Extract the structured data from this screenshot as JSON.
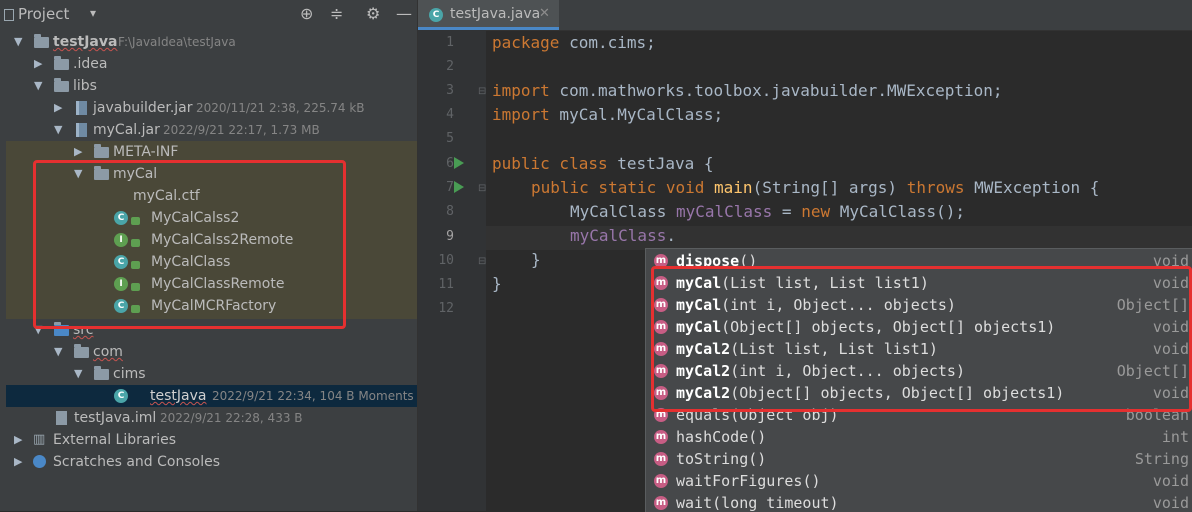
{
  "project": {
    "title": "Project",
    "tree": [
      {
        "label": "testJava",
        "meta": "F:\\JavaIdea\\testJava"
      },
      {
        "label": ".idea"
      },
      {
        "label": "libs"
      },
      {
        "label": "javabuilder.jar",
        "meta": "2020/11/21 2:38, 225.74 kB"
      },
      {
        "label": "myCal.jar",
        "meta": "2022/9/21 22:17, 1.73 MB"
      },
      {
        "label": "META-INF"
      },
      {
        "label": "myCal"
      },
      {
        "label": "myCal.ctf"
      },
      {
        "label": "MyCalCalss2"
      },
      {
        "label": "MyCalCalss2Remote"
      },
      {
        "label": "MyCalClass"
      },
      {
        "label": "MyCalClassRemote"
      },
      {
        "label": "MyCalMCRFactory"
      },
      {
        "label": "src"
      },
      {
        "label": "com"
      },
      {
        "label": "cims"
      },
      {
        "label": "testJava",
        "meta": "2022/9/21 22:34, 104 B Moments ago"
      },
      {
        "label": "testJava.iml",
        "meta": "2022/9/21 22:28, 433 B"
      },
      {
        "label": "External Libraries"
      },
      {
        "label": "Scratches and Consoles"
      }
    ]
  },
  "editor": {
    "tab": "testJava.java",
    "line_numbers": [
      "1",
      "2",
      "3",
      "4",
      "5",
      "6",
      "7",
      "8",
      "9",
      "10",
      "11",
      "12"
    ],
    "code": {
      "l1_kw": "package",
      "l1_rest": " com.cims;",
      "l3_kw": "import",
      "l3_rest": " com.mathworks.toolbox.javabuilder.MWException;",
      "l4_kw": "import",
      "l4_rest": " myCal.MyCalClass;",
      "l6_kw": "public class",
      "l6_rest": " testJava {",
      "l7_kw1": "public static void",
      "l7_fn": " main",
      "l7_mid": "(String[] args) ",
      "l7_kw2": "throws",
      "l7_end": " MWException {",
      "l8_type": "MyCalClass ",
      "l8_var": "myCalClass",
      "l8_eq": " = ",
      "l8_kw": "new",
      "l8_end": " MyCalClass();",
      "l9_var": "myCalClass",
      "l9_dot": ".",
      "l10": "}",
      "l11": "}"
    }
  },
  "completion": {
    "items": [
      {
        "name": "dispose",
        "params": "()",
        "type": "void"
      },
      {
        "name": "myCal",
        "params": "(List list, List list1)",
        "type": "void"
      },
      {
        "name": "myCal",
        "params": "(int i, Object... objects)",
        "type": "Object[]"
      },
      {
        "name": "myCal",
        "params": "(Object[] objects, Object[] objects1)",
        "type": "void"
      },
      {
        "name": "myCal2",
        "params": "(List list, List list1)",
        "type": "void"
      },
      {
        "name": "myCal2",
        "params": "(int i, Object... objects)",
        "type": "Object[]"
      },
      {
        "name": "myCal2",
        "params": "(Object[] objects, Object[] objects1)",
        "type": "void"
      },
      {
        "name": "equals",
        "params": "(Object obj)",
        "type": "boolean"
      },
      {
        "name": "hashCode",
        "params": "()",
        "type": "int"
      },
      {
        "name": "toString",
        "params": "()",
        "type": "String"
      },
      {
        "name": "waitForFigures",
        "params": "()",
        "type": "void"
      },
      {
        "name": "wait",
        "params": "(long timeout)",
        "type": "void"
      }
    ]
  }
}
